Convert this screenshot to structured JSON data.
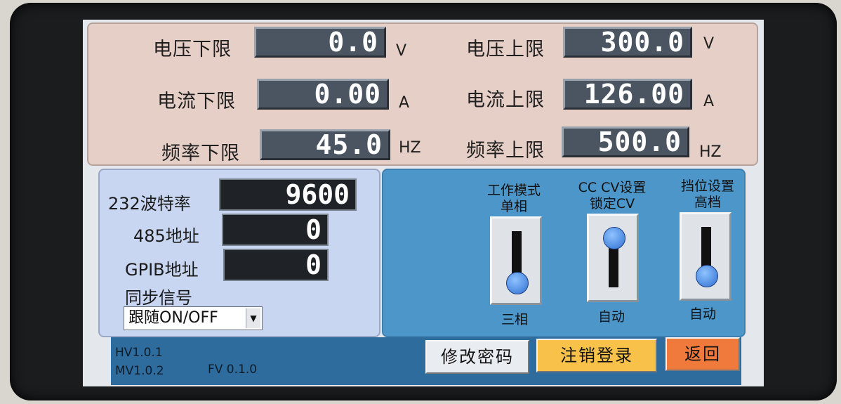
{
  "limits": {
    "voltage_low": {
      "label": "电压下限",
      "value": "0.0",
      "unit": "V"
    },
    "voltage_high": {
      "label": "电压上限",
      "value": "300.0",
      "unit": "V"
    },
    "current_low": {
      "label": "电流下限",
      "value": "0.00",
      "unit": "A"
    },
    "current_high": {
      "label": "电流上限",
      "value": "126.00",
      "unit": "A"
    },
    "freq_low": {
      "label": "频率下限",
      "value": "45.0",
      "unit": "HZ"
    },
    "freq_high": {
      "label": "频率上限",
      "value": "500.0",
      "unit": "HZ"
    }
  },
  "comm": {
    "baud": {
      "label": "232波特率",
      "value": "9600"
    },
    "addr485": {
      "label": "485地址",
      "value": "0"
    },
    "gpib": {
      "label": "GPIB地址",
      "value": "0"
    },
    "sync": {
      "label": "同步信号",
      "value": "跟随ON/OFF"
    }
  },
  "switches": {
    "mode": {
      "title1": "工作模式",
      "title2": "单相",
      "bottom": "三相"
    },
    "cccv": {
      "title1": "CC  CV设置",
      "title2": "锁定CV",
      "bottom": "自动"
    },
    "range": {
      "title1": "挡位设置",
      "title2": "高档",
      "bottom": "自动"
    }
  },
  "status": {
    "hv": "HV1.0.1",
    "mv": "MV1.0.2",
    "fv": "FV 0.1.0"
  },
  "buttons": {
    "change_password": "修改密码",
    "logout": "注销登录",
    "back": "返回"
  },
  "colors": {
    "limits_panel": "#e6cfc6",
    "comm_panel": "#c9d6f2",
    "switch_panel": "#4d96c9",
    "logout_button": "#f7c14a",
    "back_button": "#f07a3c"
  }
}
